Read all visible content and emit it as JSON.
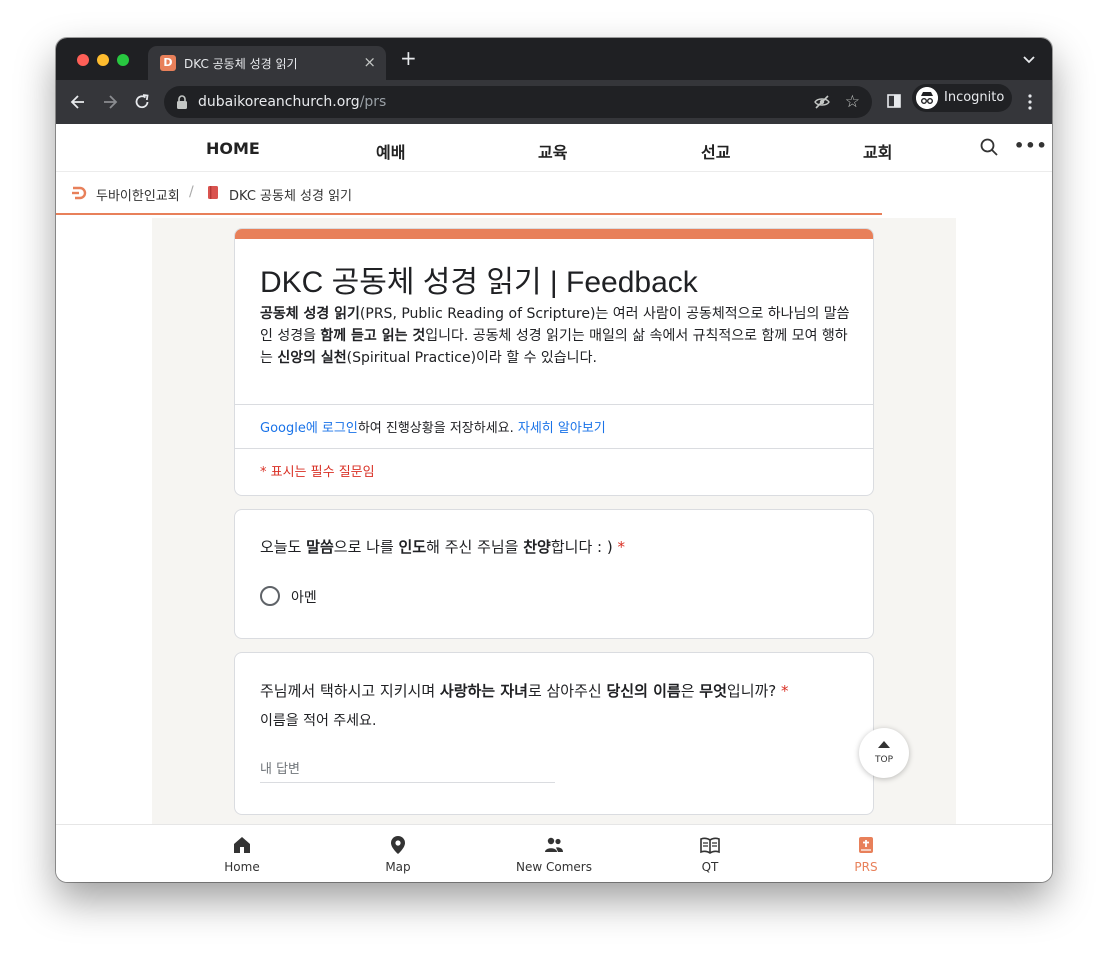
{
  "browser": {
    "tab_title": "DKC 공동체 성경 읽기",
    "tab_favicon_letter": "D",
    "tab_close": "×",
    "new_tab": "+",
    "url_host": "dubaikoreanchurch.org",
    "url_path": "/prs",
    "profile_label": "Incognito",
    "star": "☆"
  },
  "site_nav": {
    "items": [
      "HOME",
      "예배",
      "교육",
      "선교",
      "교회"
    ],
    "more": "•••"
  },
  "breadcrumb": {
    "home": "두바이한인교회",
    "separator": "/",
    "current": "DKC 공동체 성경 읽기"
  },
  "form": {
    "title": "DKC 공동체 성경 읽기 | Feedback",
    "description": {
      "b1": "공동체 성경 읽기",
      "t1": "(PRS, Public Reading of Scripture)는 여러 사람이 공동체적으로 하나님의 말씀인 성경을 ",
      "b2": "함께 듣고 읽는 것",
      "t2": "입니다. 공동체 성경 읽기는 매일의 삶 속에서 규칙적으로 함께 모여 행하는 ",
      "b3": "신앙의 실천",
      "t3": "(Spiritual Practice)이라 할 수 있습니다."
    },
    "login": {
      "google_link": "Google에 로그인",
      "text": "하여 진행상황을 저장하세요. ",
      "learn_more": "자세히 알아보기"
    },
    "required_note": "* 표시는 필수 질문임",
    "q1": {
      "p1": "오늘도 ",
      "b1": "말씀",
      "p2": "으로 나를 ",
      "b2": "인도",
      "p3": "해 주신 주님을 ",
      "b3": "찬양",
      "p4": "합니다 : ) ",
      "required": "*",
      "option": "아멘"
    },
    "q2": {
      "p1": "주님께서 택하시고 지키시며 ",
      "b1": "사랑하는 자녀",
      "p2": "로 삼아주신 ",
      "b2": "당신의 이름",
      "p3": "은 ",
      "b3": "무엇",
      "p4": "입니까?  ",
      "required": "*",
      "subtitle": "이름을 적어 주세요.",
      "placeholder": "내 답변"
    }
  },
  "top_button": "TOP",
  "bottom_nav": {
    "items": [
      {
        "label": "Home",
        "icon": "home-icon"
      },
      {
        "label": "Map",
        "icon": "map-pin-icon"
      },
      {
        "label": "New Comers",
        "icon": "people-icon"
      },
      {
        "label": "QT",
        "icon": "open-book-icon"
      },
      {
        "label": "PRS",
        "icon": "bible-icon"
      }
    ],
    "active": "PRS",
    "active_color": "#e8805a"
  },
  "colors": {
    "accent": "#e8805a",
    "link": "#1a73e8",
    "required": "#d93025"
  }
}
